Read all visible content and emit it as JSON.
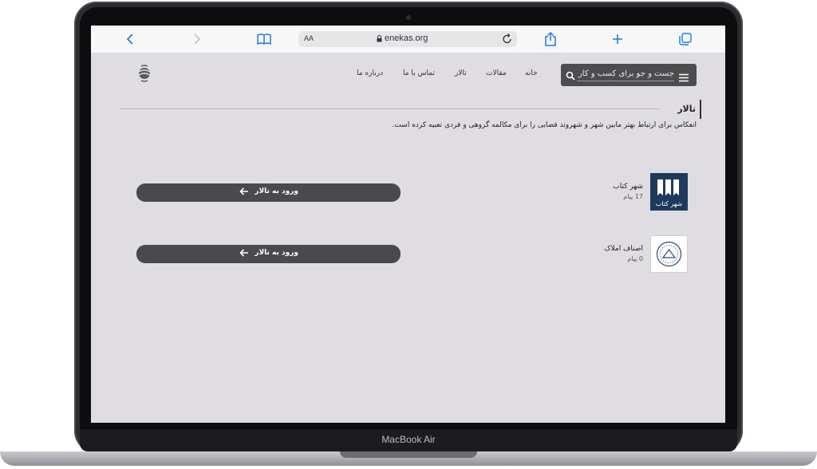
{
  "device": {
    "label": "MacBook Air"
  },
  "browser": {
    "url_text": "enekas.org",
    "reader_label": "AA"
  },
  "site": {
    "search_placeholder": "جست و جو برای کسب و کار",
    "nav": [
      "خانه",
      "مقالات",
      "تالار",
      "تماس با ما",
      "درباره ما"
    ]
  },
  "section": {
    "title": "تالار",
    "description": "انعکاس برای ارتباط بهتر مابین شهر و شهروند فضایی را برای مکالمه گروهی و فردی تعبیه کرده است."
  },
  "forums": [
    {
      "name": "شهر کتاب",
      "count": "17 پیام",
      "thumb_text": "شهر کتاب",
      "button_label": "ورود به تالار"
    },
    {
      "name": "اصناف املاک",
      "count": "0 پیام",
      "button_label": "ورود به تالار"
    }
  ],
  "colors": {
    "page_bg": "#dfdde1",
    "dark": "#4a4a4c",
    "ios_blue": "#1a7cf5",
    "thumb_blue": "#1d3a5c"
  }
}
